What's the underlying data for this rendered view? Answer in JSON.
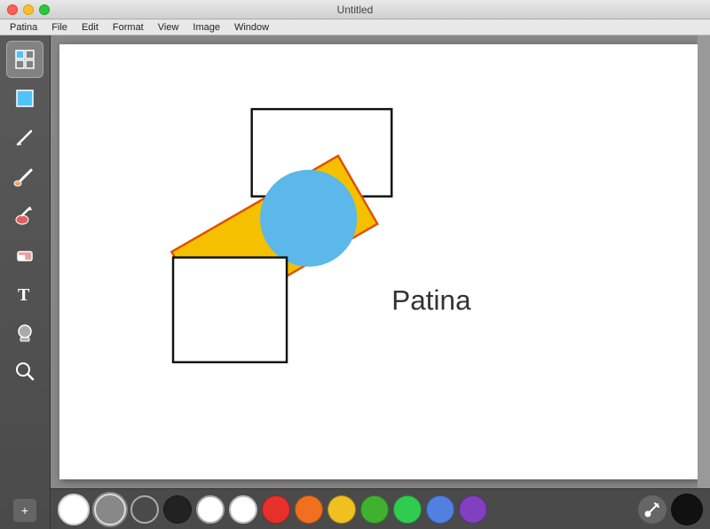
{
  "titlebar": {
    "title": "Untitled",
    "app_name": "Patina"
  },
  "menubar": {
    "items": [
      "Patina",
      "File",
      "Edit",
      "Format",
      "View",
      "Image",
      "Window"
    ]
  },
  "toolbar": {
    "tools": [
      {
        "name": "grid-tool",
        "label": "Grid",
        "icon": "grid",
        "active": true
      },
      {
        "name": "select-tool",
        "label": "Select",
        "icon": "select",
        "active": false
      },
      {
        "name": "pencil-tool",
        "label": "Pencil",
        "icon": "pencil",
        "active": false
      },
      {
        "name": "brush-tool",
        "label": "Brush",
        "icon": "brush",
        "active": false
      },
      {
        "name": "paint-tool",
        "label": "Paint",
        "icon": "paint",
        "active": false
      },
      {
        "name": "eraser-tool",
        "label": "Eraser",
        "icon": "eraser",
        "active": false
      },
      {
        "name": "text-tool",
        "label": "Text",
        "icon": "text",
        "active": false
      },
      {
        "name": "stamp-tool",
        "label": "Stamp",
        "icon": "stamp",
        "active": false
      },
      {
        "name": "zoom-tool",
        "label": "Zoom",
        "icon": "zoom",
        "active": false
      }
    ],
    "zoom_label": "+"
  },
  "palette": {
    "current_color": "white",
    "swatches": [
      {
        "color": "#888888",
        "outlined": true,
        "selected": true
      },
      {
        "color": "#cccccc",
        "outlined": true,
        "selected": false
      },
      {
        "color": "#222222",
        "outlined": false,
        "selected": false
      },
      {
        "color": "#ffffff",
        "outlined": true,
        "outlined_border": true,
        "selected": false
      },
      {
        "color": "#cccccc",
        "outlined": true,
        "selected": false
      },
      {
        "color": "#e8302a",
        "outlined": false,
        "selected": false
      },
      {
        "color": "#f07020",
        "outlined": false,
        "selected": false
      },
      {
        "color": "#f0c020",
        "outlined": false,
        "selected": false
      },
      {
        "color": "#40b030",
        "outlined": false,
        "selected": false
      },
      {
        "color": "#30cc50",
        "outlined": false,
        "selected": false
      },
      {
        "color": "#5080e0",
        "outlined": false,
        "selected": false
      },
      {
        "color": "#8040c0",
        "outlined": false,
        "selected": false
      },
      {
        "color": "#222222",
        "outlined": false,
        "selected": false
      }
    ]
  },
  "canvas": {
    "text_label": "Patina",
    "text_color": "#333333"
  }
}
